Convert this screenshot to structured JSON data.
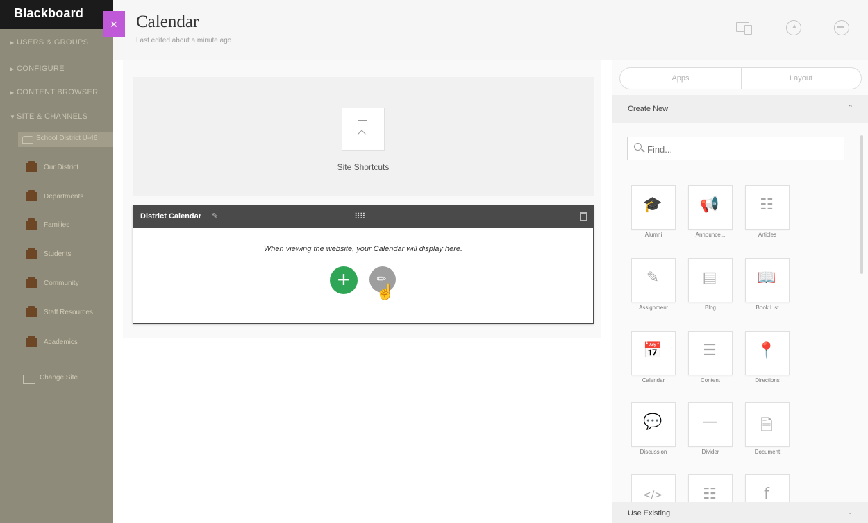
{
  "sidebar": {
    "brand": "Blackboard",
    "sections": [
      {
        "label": "USERS & GROUPS",
        "arrow": "▶"
      },
      {
        "label": "CONFIGURE",
        "arrow": "▶"
      },
      {
        "label": "CONTENT BROWSER",
        "arrow": "▶"
      },
      {
        "label": "SITE & CHANNELS",
        "arrow": "▼"
      }
    ],
    "current_site": "School District U-46",
    "items": [
      {
        "label": "Our District"
      },
      {
        "label": "Departments"
      },
      {
        "label": "Families"
      },
      {
        "label": "Students"
      },
      {
        "label": "Community"
      },
      {
        "label": "Staff Resources"
      },
      {
        "label": "Academics"
      }
    ],
    "change_site": "Change Site"
  },
  "close_icon": "×",
  "header": {
    "title": "Calendar",
    "subtitle": "Last edited about a minute ago"
  },
  "header_icons": [
    "devices-icon",
    "publish-icon",
    "more-icon"
  ],
  "shortcuts": {
    "label": "Site Shortcuts"
  },
  "calendar_widget": {
    "title": "District Calendar",
    "edit_icon": "✎",
    "drag_icon": "⠿⠿",
    "message": "When viewing the website, your Calendar will display here.",
    "add_symbol": "+",
    "edit_symbol": "✎"
  },
  "panel": {
    "tabs": [
      "Apps",
      "Layout"
    ],
    "create_new": "Create New",
    "create_chevron": "⌃",
    "search_placeholder": "Find...",
    "apps": [
      {
        "label": "Alumni",
        "symbol": "🎓"
      },
      {
        "label": "Announce...",
        "symbol": "📢"
      },
      {
        "label": "Articles",
        "symbol": "☷"
      },
      {
        "label": "Assignment",
        "symbol": "✎"
      },
      {
        "label": "Blog",
        "symbol": "▤"
      },
      {
        "label": "Book List",
        "symbol": "📖"
      },
      {
        "label": "Calendar",
        "symbol": "📅"
      },
      {
        "label": "Content",
        "symbol": "☰"
      },
      {
        "label": "Directions",
        "symbol": "📍"
      },
      {
        "label": "Discussion",
        "symbol": "💬"
      },
      {
        "label": "Divider",
        "symbol": "—"
      },
      {
        "label": "Document",
        "symbol": "🗎"
      },
      {
        "label": "",
        "symbol": "</>"
      },
      {
        "label": "",
        "symbol": "☷"
      },
      {
        "label": "",
        "symbol": "f"
      }
    ],
    "use_existing": "Use Existing",
    "use_existing_chevron": "⌄"
  },
  "colors": {
    "sidebar_bg": "#8e8b7a",
    "close_button": "#c059d8",
    "add_button": "#2ea655",
    "widget_bar": "#4a4a4a"
  }
}
